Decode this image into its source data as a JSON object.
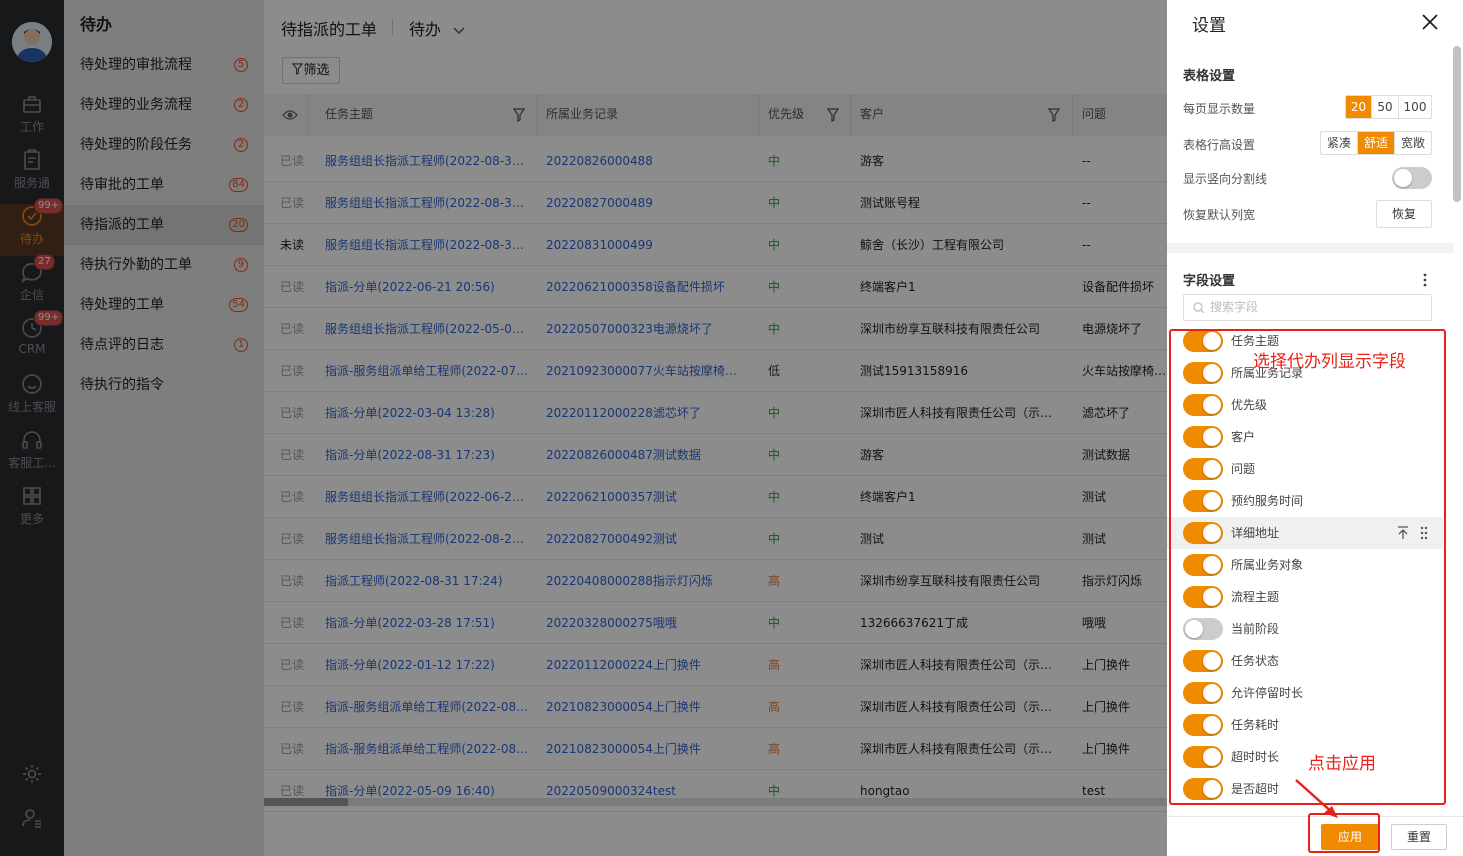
{
  "rail": {
    "items": [
      {
        "label": "工作",
        "icon": "briefcase-icon",
        "badge": ""
      },
      {
        "label": "服务通",
        "icon": "clipboard-icon",
        "badge": ""
      },
      {
        "label": "待办",
        "icon": "check-circle-icon",
        "badge": "99+"
      },
      {
        "label": "企信",
        "icon": "chat-icon",
        "badge": "27"
      },
      {
        "label": "CRM",
        "icon": "clock-icon",
        "badge": "99+"
      },
      {
        "label": "线上客服",
        "icon": "smile-icon",
        "badge": ""
      },
      {
        "label": "客服工...",
        "icon": "headset-icon",
        "badge": ""
      },
      {
        "label": "更多",
        "icon": "grid-icon",
        "badge": ""
      }
    ],
    "bottom_icons": [
      "settings-icon",
      "user-settings-icon"
    ]
  },
  "sidebar": {
    "title": "待办",
    "items": [
      {
        "label": "待处理的审批流程",
        "count": "5"
      },
      {
        "label": "待处理的业务流程",
        "count": "2"
      },
      {
        "label": "待处理的阶段任务",
        "count": "2"
      },
      {
        "label": "待审批的工单",
        "count": "84"
      },
      {
        "label": "待指派的工单",
        "count": "20"
      },
      {
        "label": "待执行外勤的工单",
        "count": "9"
      },
      {
        "label": "待处理的工单",
        "count": "54"
      },
      {
        "label": "待点评的日志",
        "count": "1"
      },
      {
        "label": "待执行的指令",
        "count": ""
      }
    ]
  },
  "main": {
    "title": "待指派的工单",
    "view": "待办",
    "filter_label": "筛选",
    "columns": [
      "任务主题",
      "所属业务记录",
      "优先级",
      "客户",
      "问题"
    ],
    "rows": [
      {
        "read": "已读",
        "subject": "服务组组长指派工程师(2022-08-30 …",
        "record": "20220826000488",
        "priority": "中",
        "customer": "游客",
        "problem": "--"
      },
      {
        "read": "已读",
        "subject": "服务组组长指派工程师(2022-08-30 …",
        "record": "20220827000489",
        "priority": "中",
        "customer": "测试账号程",
        "problem": "--"
      },
      {
        "read": "未读",
        "subject": "服务组组长指派工程师(2022-08-31 …",
        "record": "20220831000499",
        "priority": "中",
        "customer": "鲸舍（长沙）工程有限公司",
        "problem": "--"
      },
      {
        "read": "已读",
        "subject": "指派-分单(2022-06-21 20:56)",
        "record": "20220621000358设备配件损坏",
        "priority": "中",
        "customer": "终端客户1",
        "problem": "设备配件损坏"
      },
      {
        "read": "已读",
        "subject": "服务组组长指派工程师(2022-05-07 …",
        "record": "20220507000323电源烧坏了",
        "priority": "中",
        "customer": "深圳市纷享互联科技有限责任公司",
        "problem": "电源烧坏了"
      },
      {
        "read": "已读",
        "subject": "指派-服务组派单给工程师(2022-07-…",
        "record": "20210923000077火车站按摩椅子坏了",
        "priority": "低",
        "customer": "测试15913158916",
        "problem": "火车站按摩椅子坏了"
      },
      {
        "read": "已读",
        "subject": "指派-分单(2022-03-04 13:28)",
        "record": "20220112000228滤芯坏了",
        "priority": "中",
        "customer": "深圳市匠人科技有限责任公司（示…",
        "problem": "滤芯坏了"
      },
      {
        "read": "已读",
        "subject": "指派-分单(2022-08-31 17:23)",
        "record": "20220826000487测试数据",
        "priority": "中",
        "customer": "游客",
        "problem": "测试数据"
      },
      {
        "read": "已读",
        "subject": "服务组组长指派工程师(2022-06-21 …",
        "record": "20220621000357测试",
        "priority": "中",
        "customer": "终端客户1",
        "problem": "测试"
      },
      {
        "read": "已读",
        "subject": "服务组组长指派工程师(2022-08-27 …",
        "record": "20220827000492测试",
        "priority": "中",
        "customer": "测试",
        "problem": "测试"
      },
      {
        "read": "已读",
        "subject": "指派工程师(2022-08-31 17:24)",
        "record": "20220408000288指示灯闪烁",
        "priority": "高",
        "customer": "深圳市纷享互联科技有限责任公司",
        "problem": "指示灯闪烁"
      },
      {
        "read": "已读",
        "subject": "指派-分单(2022-03-28 17:51)",
        "record": "20220328000275哦哦",
        "priority": "中",
        "customer": "13266637621丁成",
        "problem": "哦哦"
      },
      {
        "read": "已读",
        "subject": "指派-分单(2022-01-12 17:22)",
        "record": "20220112000224上门换件",
        "priority": "高",
        "customer": "深圳市匠人科技有限责任公司（示…",
        "problem": "上门换件"
      },
      {
        "read": "已读",
        "subject": "指派-服务组派单给工程师(2022-08-…",
        "record": "20210823000054上门换件",
        "priority": "高",
        "customer": "深圳市匠人科技有限责任公司（示…",
        "problem": "上门换件"
      },
      {
        "read": "已读",
        "subject": "指派-服务组派单给工程师(2022-08-…",
        "record": "20210823000054上门换件",
        "priority": "高",
        "customer": "深圳市匠人科技有限责任公司（示…",
        "problem": "上门换件"
      },
      {
        "read": "已读",
        "subject": "指派-分单(2022-05-09 16:40)",
        "record": "20220509000324test",
        "priority": "中",
        "customer": "hongtao",
        "problem": "test"
      }
    ]
  },
  "panel": {
    "title": "设置",
    "table_settings": {
      "title": "表格设置",
      "page_size_label": "每页显示数量",
      "page_sizes": [
        "20",
        "50",
        "100"
      ],
      "page_size_selected": "20",
      "row_height_label": "表格行高设置",
      "row_heights": [
        "紧凑",
        "舒适",
        "宽敞"
      ],
      "row_height_selected": "舒适",
      "vertical_lines_label": "显示竖向分割线",
      "vertical_lines_on": false,
      "restore_label": "恢复默认列宽",
      "restore_button": "恢复"
    },
    "field_settings": {
      "title": "字段设置",
      "search_placeholder": "搜索字段",
      "fields": [
        {
          "label": "任务主题",
          "on": true
        },
        {
          "label": "所属业务记录",
          "on": true
        },
        {
          "label": "优先级",
          "on": true
        },
        {
          "label": "客户",
          "on": true
        },
        {
          "label": "问题",
          "on": true
        },
        {
          "label": "预约服务时间",
          "on": true
        },
        {
          "label": "详细地址",
          "on": true
        },
        {
          "label": "所属业务对象",
          "on": true
        },
        {
          "label": "流程主题",
          "on": true
        },
        {
          "label": "当前阶段",
          "on": false
        },
        {
          "label": "任务状态",
          "on": true
        },
        {
          "label": "允许停留时长",
          "on": true
        },
        {
          "label": "任务耗时",
          "on": true
        },
        {
          "label": "超时时长",
          "on": true
        },
        {
          "label": "是否超时",
          "on": true
        }
      ]
    },
    "apply_button": "应用",
    "reset_button": "重置"
  },
  "annotations": {
    "fields_note": "选择代办列显示字段",
    "apply_note": "点击应用"
  },
  "colors": {
    "accent": "#f08a00",
    "link": "#2f64d4",
    "priority_mid": "#2aa52a",
    "priority_high": "#e8742a",
    "annotation": "#e8221a",
    "rail_bg": "#2b2c30"
  }
}
